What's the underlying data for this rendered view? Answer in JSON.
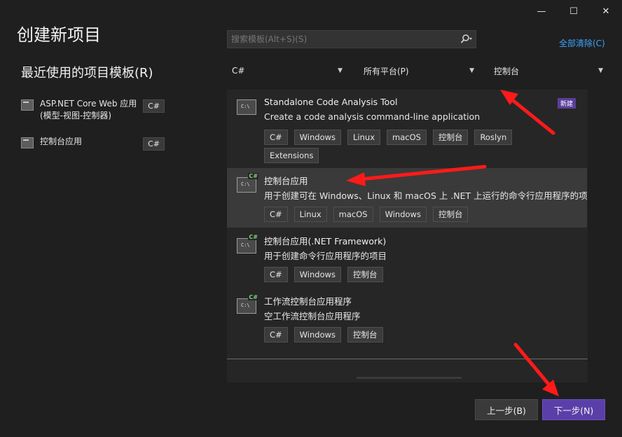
{
  "window": {
    "title": "创建新项目",
    "controls": {
      "minimize": "—",
      "maximize": "☐",
      "close": "✕"
    }
  },
  "recent": {
    "heading": "最近使用的项目模板(R)",
    "items": [
      {
        "name": "ASP.NET Core Web 应用(模型-视图-控制器)",
        "lang": "C#",
        "icon": "web-app-icon"
      },
      {
        "name": "控制台应用",
        "lang": "C#",
        "icon": "console-app-icon"
      }
    ]
  },
  "search": {
    "placeholder": "搜索模板(Alt+S)(S)",
    "value": "",
    "icon": "search-icon"
  },
  "clear_all": "全部清除(C)",
  "filters": {
    "language": "C#",
    "platform": "所有平台(P)",
    "project_type": "控制台"
  },
  "templates": [
    {
      "title": "Standalone Code Analysis Tool",
      "desc": "Create a code analysis command-line application",
      "badge": "新建",
      "tags": [
        "C#",
        "Windows",
        "Linux",
        "macOS",
        "控制台",
        "Roslyn",
        "Extensions"
      ],
      "icon_text": "C:\\",
      "icon_name": "code-analysis-icon"
    },
    {
      "title": "控制台应用",
      "desc": "用于创建可在 Windows、Linux 和 macOS 上 .NET 上运行的命令行应用程序的项目",
      "tags": [
        "C#",
        "Linux",
        "macOS",
        "Windows",
        "控制台"
      ],
      "icon_text": "C:\\",
      "cs_mark": "C#",
      "icon_name": "console-app-icon",
      "selected": true
    },
    {
      "title": "控制台应用(.NET Framework)",
      "desc": "用于创建命令行应用程序的项目",
      "tags": [
        "C#",
        "Windows",
        "控制台"
      ],
      "icon_text": "C:\\",
      "cs_mark": "C#",
      "icon_name": "console-app-icon"
    },
    {
      "title": "工作流控制台应用程序",
      "desc": "空工作流控制台应用程序",
      "tags": [
        "C#",
        "Windows",
        "控制台"
      ],
      "icon_text": "C:\\",
      "cs_mark": "C#",
      "icon_name": "workflow-console-icon"
    }
  ],
  "buttons": {
    "back": "上一步(B)",
    "next": "下一步(N)"
  },
  "colors": {
    "background": "#1f1f1f",
    "accent": "#5b3fa8",
    "link": "#3ea6ff",
    "annotation_arrow": "#ff1a1a"
  }
}
